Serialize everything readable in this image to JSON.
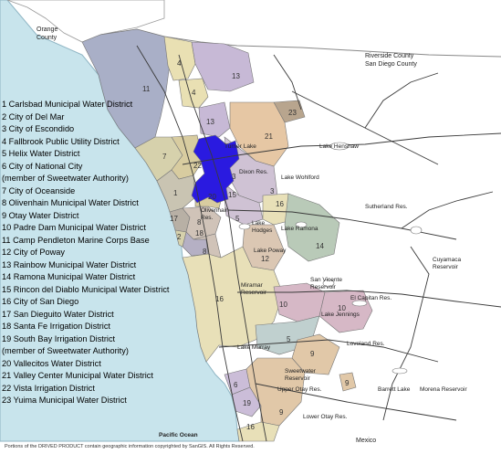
{
  "legend": [
    "1 Carlsbad Municipal Water District",
    "2 City of Del Mar",
    "3 City of Escondido",
    "4 Fallbrook Public Utility District",
    "5 Helix Water District",
    "6 City of National City",
    "(member of Sweetwater Authority)",
    "7 City of Oceanside",
    "8 Olivenhain Municipal Water District",
    "9 Otay Water District",
    "10 Padre Dam Municipal Water District",
    "11 Camp Pendleton Marine Corps Base",
    "12 City of Poway",
    "13 Rainbow Municipal Water District",
    "14 Ramona Municipal Water District",
    "15 Rincon del Diablo Municipal Water District",
    "16 City of San Diego",
    "17 San Dieguito Water District",
    "18 Santa Fe Irrigation District",
    "19 South Bay Irrigation District",
    "(member of Sweetwater Authority)",
    "20 Vallecitos Water District",
    "21 Valley Center Municipal Water District",
    "22 Vista Irrigation District",
    "23 Yuima Municipal Water District"
  ],
  "county_labels": {
    "orange": [
      "Orange",
      "County"
    ],
    "riverside": [
      "Riverside County",
      "San Diego County"
    ]
  },
  "place_labels": {
    "turner_lake": "Turner Lake",
    "lake_henshaw": "Lake Henshaw",
    "dixon_res": "Dixon Res.",
    "lake_wohlford": "Lake Wohlford",
    "sutherland_res": "Sutherland Res.",
    "olivenhain_res": [
      "Olivenhain",
      "Res."
    ],
    "lake_hodges": [
      "Lake",
      "Hodges"
    ],
    "lake_ramona": "Lake Ramona",
    "lake_poway": "Lake Poway",
    "cuyamaca_res": [
      "Cuyamaca",
      "Reservoir"
    ],
    "san_vicente_res": [
      "San Vicente",
      "Reservoir"
    ],
    "miramar_res": [
      "Miramar",
      "Reservoir"
    ],
    "el_capitan_res": "El Capitan Res.",
    "lake_jennings": "Lake Jennings",
    "lake_murray": "Lake Murray",
    "loveland_res": "Loveland Res.",
    "sweetwater_res": [
      "Sweetwater",
      "Reservoir"
    ],
    "upper_otay_res": "Upper Otay Res.",
    "barrett_lake": "Barrett Lake",
    "morena_res": "Morena Reservoir",
    "lower_otay_res": "Lower Otay Res.",
    "pacific_ocean": "Pacific Ocean",
    "mexico": "Mexico"
  },
  "district_numbers": [
    "11",
    "4",
    "13",
    "4",
    "23",
    "13",
    "21",
    "7",
    "22",
    "3",
    "1",
    "20",
    "15",
    "3",
    "16",
    "17",
    "8",
    "2",
    "18",
    "5",
    "12",
    "14",
    "8",
    "16",
    "10",
    "10",
    "5",
    "9",
    "6",
    "9",
    "19",
    "9",
    "16"
  ],
  "credit": "Portions of the DRIVED PRODUCT contain geographic information copyrighted by SanGIS. All Rights Reserved.",
  "colors": {
    "ocean": "#c8e4ec",
    "background": "#ffffff",
    "highlight": "#2a1ae0",
    "pendleton": "#a9afc7",
    "fallbrook": "#e9e0b3",
    "rainbow": "#c7b9d6",
    "yuima": "#b8a58e",
    "valley_center": "#e6c7a4",
    "escondido": "#cfc2d4",
    "vista": "#d8cca0",
    "carlsbad": "#c9c4b2",
    "oceanside": "#d6d1ac",
    "san_diego": "#e8e0b8",
    "poway": "#dbc7b3",
    "ramona": "#b9cab8",
    "padre_dam": "#d6b8c6",
    "helix": "#c0d0cf",
    "otay": "#e1c8a8",
    "sweetwater": "#cbbdd8",
    "olivenhain": "#d0c3b8",
    "santa_fe": "#b5b0c4",
    "san_dieguito": "#b8b0a5",
    "road": "#3a3a3a",
    "county_line": "#888888"
  }
}
